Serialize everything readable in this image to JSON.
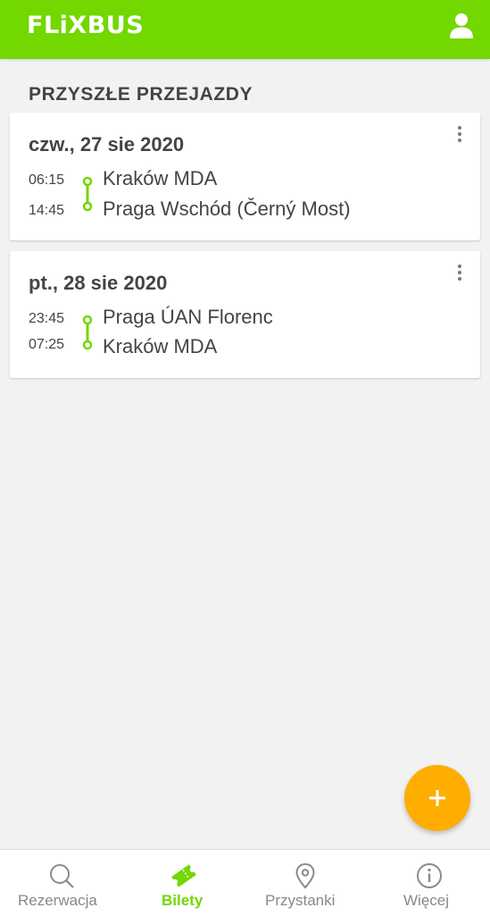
{
  "header": {
    "logo": "FLiXBUS",
    "brand_color": "#73d700",
    "profile_icon": "user-icon"
  },
  "section_title": "PRZYSZŁE PRZEJAZDY",
  "trips": [
    {
      "date": "czw., 27 sie 2020",
      "departure_time": "06:15",
      "departure_station": "Kraków MDA",
      "arrival_time": "14:45",
      "arrival_station": "Praga Wschód (Černý Most)"
    },
    {
      "date": "pt., 28 sie 2020",
      "departure_time": "23:45",
      "departure_station": "Praga ÚAN Florenc",
      "arrival_time": "07:25",
      "arrival_station": "Kraków MDA"
    }
  ],
  "fab": {
    "icon": "plus-icon",
    "color": "#ffad00"
  },
  "bottom_nav": {
    "items": [
      {
        "label": "Rezerwacja",
        "icon": "search-icon",
        "active": false
      },
      {
        "label": "Bilety",
        "icon": "ticket-icon",
        "active": true
      },
      {
        "label": "Przystanki",
        "icon": "location-pin-icon",
        "active": false
      },
      {
        "label": "Więcej",
        "icon": "info-icon",
        "active": false
      }
    ]
  }
}
